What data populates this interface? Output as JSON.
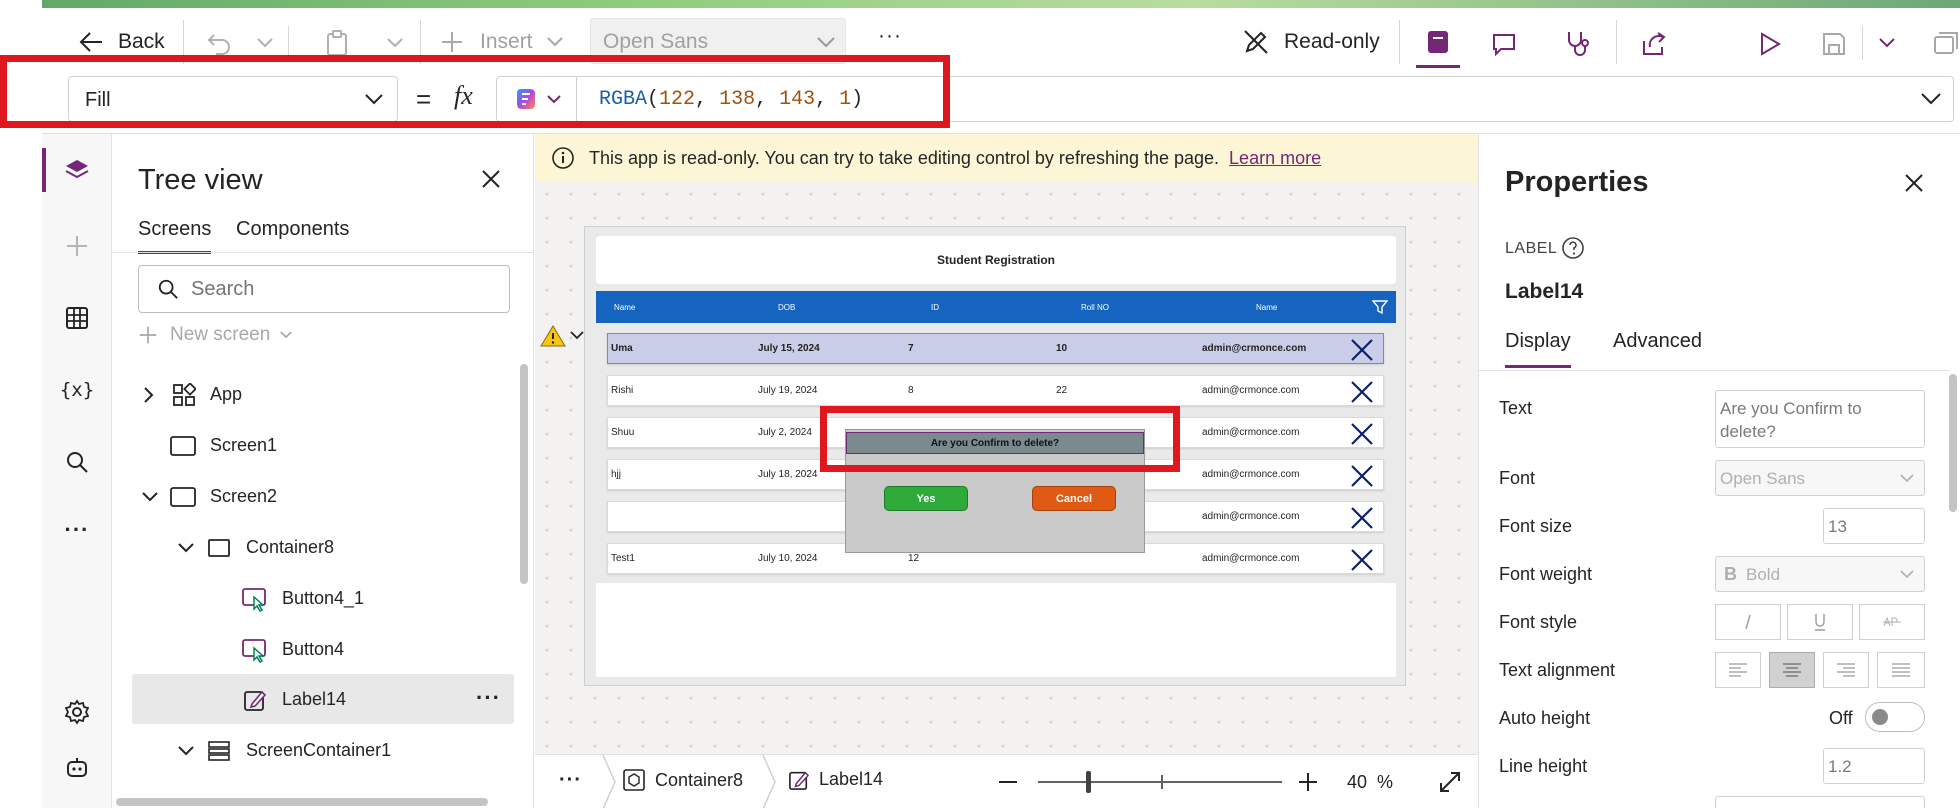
{
  "toolbar": {
    "back_label": "Back",
    "insert_label": "Insert",
    "font_value": "Open Sans",
    "more_label": "···",
    "readonly_label": "Read-only"
  },
  "formula": {
    "property": "Fill",
    "equals": "=",
    "fx": "fx",
    "fn": "RGBA",
    "open": "(",
    "args": [
      "122",
      "138",
      "143",
      "1"
    ],
    "sep": ", ",
    "close": ")"
  },
  "tree": {
    "title": "Tree view",
    "tabs": [
      "Screens",
      "Components"
    ],
    "search_placeholder": "Search",
    "new_screen": "New screen",
    "nodes": [
      "App",
      "Screen1",
      "Screen2",
      "Container8",
      "Button4_1",
      "Button4",
      "Label14",
      "ScreenContainer1"
    ],
    "more": "···"
  },
  "infobar": {
    "message": "This app is read-only. You can try to take editing control by refreshing the page.",
    "link": "Learn more"
  },
  "app": {
    "title": "Student Registration",
    "headers": [
      "Name",
      "DOB",
      "ID",
      "Roll NO",
      "Name"
    ],
    "rows": [
      {
        "name": "Uma",
        "dob": "July 15, 2024",
        "id": "7",
        "roll": "10",
        "email": "admin@crmonce.com"
      },
      {
        "name": "Rishi",
        "dob": "July 19, 2024",
        "id": "8",
        "roll": "22",
        "email": "admin@crmonce.com"
      },
      {
        "name": "Shuu",
        "dob": "July 2, 2024",
        "id": "",
        "roll": "",
        "email": "admin@crmonce.com"
      },
      {
        "name": "hjj",
        "dob": "July 18, 2024",
        "id": "",
        "roll": "",
        "email": "admin@crmonce.com"
      },
      {
        "name": "",
        "dob": "",
        "id": "",
        "roll": "",
        "email": "admin@crmonce.com"
      },
      {
        "name": "Test1",
        "dob": "July 10, 2024",
        "id": "12",
        "roll": "",
        "email": "admin@crmonce.com"
      }
    ],
    "dialog": {
      "message": "Are you Confirm to delete?",
      "yes": "Yes",
      "cancel": "Cancel"
    }
  },
  "bottombar": {
    "more": "···",
    "crumbs": [
      "Container8",
      "Label14"
    ],
    "zoom": "40",
    "zoom_unit": "%",
    "zoom_level": 0.2
  },
  "props": {
    "title": "Properties",
    "type": "LABEL",
    "name": "Label14",
    "tabs": [
      "Display",
      "Advanced"
    ],
    "labels": [
      "Text",
      "Font",
      "Font size",
      "Font weight",
      "Font style",
      "Text alignment",
      "Auto height",
      "Line height"
    ],
    "text_value": "Are you Confirm to delete?",
    "font_value": "Open Sans",
    "font_size": "13",
    "font_weight": "Bold",
    "auto_height": "Off",
    "line_height": "1.2"
  },
  "colors": {
    "accent": "#742774",
    "header_blue": "#1565c0",
    "yes_green": "#2eaa3a",
    "cancel_orange": "#e05a13",
    "dialog_gray": "#7a8a8f",
    "highlight_red": "#e0171f"
  }
}
